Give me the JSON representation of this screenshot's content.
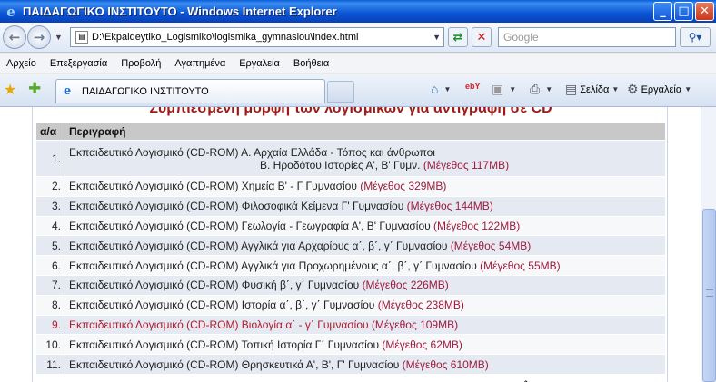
{
  "window": {
    "title": "ΠΑΙΔΑΓΩΓΙΚΟ ΙΝΣΤΙΤΟΥΤΟ - Windows Internet Explorer",
    "minimize": "_",
    "maximize": "□",
    "close": "✕"
  },
  "address": {
    "url": "D:\\Ekpaideytiko_Logismiko\\logismika_gymnasiou\\index.html",
    "search_placeholder": "Google"
  },
  "menu": [
    "Αρχείο",
    "Επεξεργασία",
    "Προβολή",
    "Αγαπημένα",
    "Εργαλεία",
    "Βοήθεια"
  ],
  "tab": {
    "label": "ΠΑΙΔΑΓΩΓΙΚΟ ΙΝΣΤΙΤΟΥΤΟ"
  },
  "toolbar": {
    "page": "Σελίδα",
    "tools": "Εργαλεία"
  },
  "page": {
    "heading": "Συμπιεσμένη μορφή των λογισμικών για αντιγραφή σε CD",
    "col_num": "α/α",
    "col_desc": "Περιγραφή",
    "rows": [
      {
        "num": "1.",
        "desc": "Εκπαιδευτικό Λογισμικό (CD-ROM) Α. Αρχαία Ελλάδα - Τόπος και άνθρωποι",
        "desc2": "Β. Ηροδότου Ιστορίες Α', Β' Γυμν.",
        "size": "(Μέγεθος 117MB)"
      },
      {
        "num": "2.",
        "desc": "Εκπαιδευτικό Λογισμικό (CD-ROM) Χημεία Β' - Γ Γυμνασίου",
        "size": "(Μέγεθος 329MB)"
      },
      {
        "num": "3.",
        "desc": "Εκπαιδευτικό Λογισμικό (CD-ROM) Φιλοσοφικά Κείμενα Γ' Γυμνασίου",
        "size": "(Μέγεθος 144MB)"
      },
      {
        "num": "4.",
        "desc": "Εκπαιδευτικό Λογισμικό (CD-ROM) Γεωλογία - Γεωγραφία Α', Β' Γυμνασίου",
        "size": "(Μέγεθος 122MB)"
      },
      {
        "num": "5.",
        "desc": "Εκπαιδευτικό Λογισμικό (CD-ROM) Αγγλικά για Αρχαρίους α΄, β΄, γ΄ Γυμνασίου",
        "size": "(Μέγεθος 54MB)"
      },
      {
        "num": "6.",
        "desc": "Εκπαιδευτικό Λογισμικό (CD-ROM) Αγγλικά για Προχωρημένους α΄, β΄, γ΄ Γυμνασίου",
        "size": "(Μέγεθος 55MB)"
      },
      {
        "num": "7.",
        "desc": "Εκπαιδευτικό Λογισμικό (CD-ROM) Φυσική β΄, γ΄ Γυμνασίου",
        "size": "(Μέγεθος 226MB)"
      },
      {
        "num": "8.",
        "desc": "Εκπαιδευτικό Λογισμικό (CD-ROM) Ιστορία α΄, β΄, γ΄ Γυμνασίου",
        "size": "(Μέγεθος 238MB)"
      },
      {
        "num": "9.",
        "desc": "Εκπαιδευτικό Λογισμικό (CD-ROM) Βιολογία α΄ - γ΄ Γυμνασίου",
        "size": "(Μέγεθος 109MB)",
        "hover": true
      },
      {
        "num": "10.",
        "desc": "Εκπαιδευτικό Λογισμικό (CD-ROM) Τοπική Ιστορία Γ΄ Γυμνασίου",
        "size": "(Μέγεθος 62MB)"
      },
      {
        "num": "11.",
        "desc": "Εκπαιδευτικό Λογισμικό (CD-ROM) Θρησκευτικά Α', Β', Γ' Γυμνασίου",
        "size": "(Μέγεθος 610MB)"
      }
    ]
  },
  "colors": {
    "size_text": "#9e1a3c",
    "heading": "#a01818",
    "row_alt": "#e4e9f2"
  }
}
